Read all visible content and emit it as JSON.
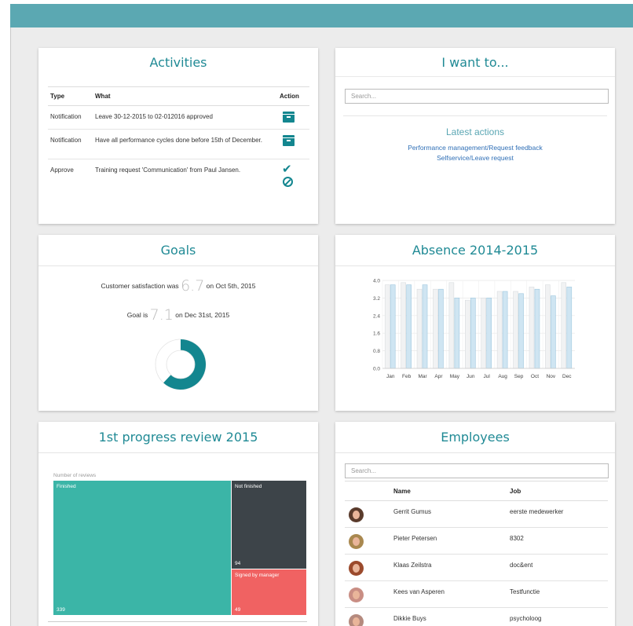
{
  "activities": {
    "title": "Activities",
    "headers": {
      "type": "Type",
      "what": "What",
      "action": "Action"
    },
    "rows": [
      {
        "type": "Notification",
        "what": "Leave 30-12-2015 to 02-012016 approved",
        "action": "archive-icon"
      },
      {
        "type": "Notification",
        "what": "Have all performance cycles done before 15th of December.",
        "action": "archive-icon"
      },
      {
        "type": "Approve",
        "what": "Training request 'Communication' from Paul Jansen.",
        "action": "approve-reject-icons"
      }
    ]
  },
  "want": {
    "title": "I want to...",
    "search_placeholder": "Search...",
    "latest_title": "Latest actions",
    "links": [
      "Performance management/Request feedback",
      "Selfservice/Leave request"
    ]
  },
  "goals": {
    "title": "Goals",
    "line1_prefix": "Customer satisfaction was",
    "line1_value": "6.7",
    "line1_suffix": "on Oct 5th, 2015",
    "line2_prefix": "Goal is",
    "line2_value": "7.1",
    "line2_suffix": "on Dec 31st, 2015",
    "donut_fraction": 0.62,
    "colors": {
      "fill": "#13868f",
      "track": "#ffffff"
    }
  },
  "absence": {
    "title": "Absence 2014-2015"
  },
  "chart_data": {
    "type": "bar",
    "categories": [
      "Jan",
      "Feb",
      "Mar",
      "Apr",
      "May",
      "Jun",
      "Jul",
      "Aug",
      "Sep",
      "Oct",
      "Nov",
      "Dec"
    ],
    "series": [
      {
        "values": [
          3.8,
          3.9,
          3.6,
          3.6,
          3.9,
          3.1,
          3.2,
          3.5,
          3.5,
          3.7,
          3.8,
          3.9
        ]
      },
      {
        "values": [
          3.8,
          3.8,
          3.8,
          3.6,
          3.2,
          3.2,
          3.2,
          3.5,
          3.4,
          3.6,
          3.3,
          3.7
        ]
      }
    ],
    "yticks": [
      "4.0",
      "3.2",
      "2.4",
      "1.6",
      "0.8",
      "0.0"
    ],
    "ylim": [
      0,
      4.0
    ],
    "grid": true,
    "colors": {
      "series0": "#f1f2f3",
      "series1": "#cfe5f2"
    }
  },
  "progress": {
    "title": "1st progress review 2015",
    "caption": "Number of reviews",
    "cells": [
      {
        "label": "Finished",
        "value": "339",
        "color": "#3bb5a7"
      },
      {
        "label": "Not finished",
        "value": "94",
        "color": "#3d4449"
      },
      {
        "label": "Signed by manager",
        "value": "49",
        "color": "#f06262"
      }
    ]
  },
  "employees": {
    "title": "Employees",
    "search_placeholder": "Search...",
    "headers": {
      "name": "Name",
      "job": "Job"
    },
    "rows": [
      {
        "name": "Gerrit Gumus",
        "job": "eerste medewerker",
        "avatar_color": "#5a3b2c"
      },
      {
        "name": "Pieter Petersen",
        "job": "8302",
        "avatar_color": "#a9884f"
      },
      {
        "name": "Klaas Zeilstra",
        "job": "doc&ent",
        "avatar_color": "#9b4a2c"
      },
      {
        "name": "Kees van Asperen",
        "job": "Testfunctie",
        "avatar_color": "#c98e84"
      },
      {
        "name": "Dikkie Buys",
        "job": "psycholoog",
        "avatar_color": "#b58a7e"
      }
    ]
  },
  "colors": {
    "header": "#5ba8b2",
    "accent": "#208a95",
    "link": "#2f6fb6"
  }
}
